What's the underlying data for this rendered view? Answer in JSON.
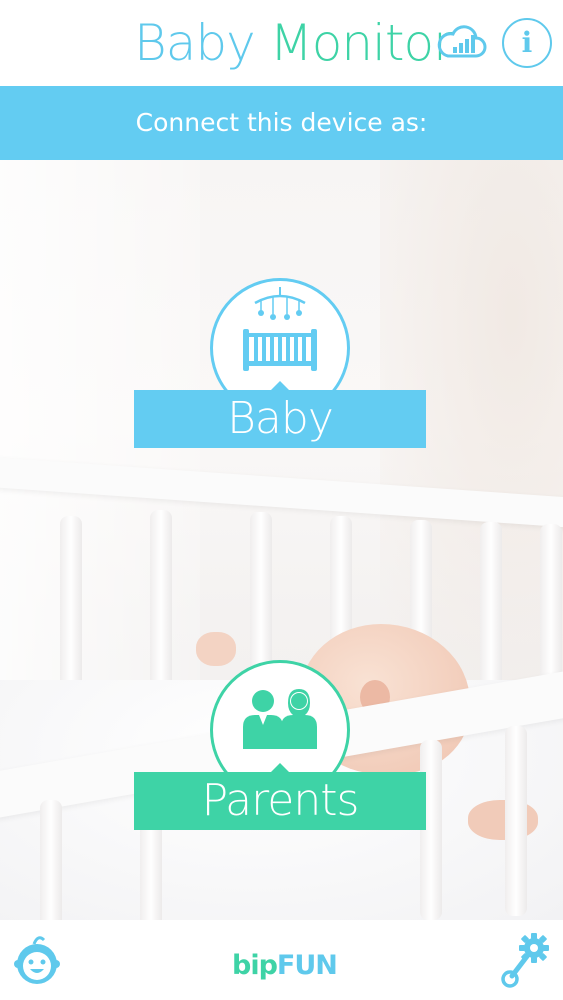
{
  "header": {
    "title_part1": "Baby",
    "title_part2": "Monitor",
    "cloud_icon": "cloud-signal-icon",
    "info_label": "i"
  },
  "banner": {
    "text": "Connect this device as:"
  },
  "roles": {
    "baby": {
      "label": "Baby",
      "icon": "crib-mobile-icon"
    },
    "parents": {
      "label": "Parents",
      "icon": "parents-icon"
    }
  },
  "footer": {
    "brand_part1": "bip",
    "brand_part2": "FUN",
    "left_icon": "baby-face-icon",
    "right_icon": "settings-gear-icon"
  },
  "colors": {
    "blue": "#63ccf2",
    "green": "#3ed3a6",
    "title_blue": "#5fc9ec"
  }
}
